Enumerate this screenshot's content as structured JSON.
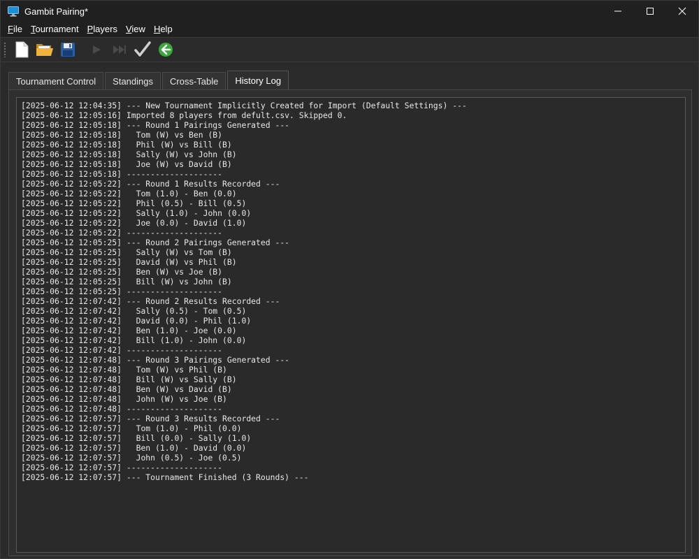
{
  "window": {
    "title": "Gambit Pairing*"
  },
  "menu": {
    "items": [
      {
        "label": "File",
        "mnemonic": "F",
        "rest": "ile"
      },
      {
        "label": "Tournament",
        "mnemonic": "T",
        "rest": "ournament"
      },
      {
        "label": "Players",
        "mnemonic": "P",
        "rest": "layers"
      },
      {
        "label": "View",
        "mnemonic": "V",
        "rest": "iew"
      },
      {
        "label": "Help",
        "mnemonic": "H",
        "rest": "elp"
      }
    ]
  },
  "toolbar": {
    "icons": [
      "new-document-icon",
      "open-folder-icon",
      "save-icon",
      "play-icon",
      "fast-forward-icon",
      "checkmark-icon",
      "back-arrow-icon"
    ]
  },
  "tabs": [
    {
      "label": "Tournament Control",
      "active": false
    },
    {
      "label": "Standings",
      "active": false
    },
    {
      "label": "Cross-Table",
      "active": false
    },
    {
      "label": "History Log",
      "active": true
    }
  ],
  "colors": {
    "background": "#2b2b2b",
    "accent_green": "#3aa83a",
    "titlebar": "#202020"
  },
  "history_log": [
    "[2025-06-12 12:04:35] --- New Tournament Implicitly Created for Import (Default Settings) ---",
    "[2025-06-12 12:05:16] Imported 8 players from defult.csv. Skipped 0.",
    "[2025-06-12 12:05:18] --- Round 1 Pairings Generated ---",
    "[2025-06-12 12:05:18]   Tom (W) vs Ben (B)",
    "[2025-06-12 12:05:18]   Phil (W) vs Bill (B)",
    "[2025-06-12 12:05:18]   Sally (W) vs John (B)",
    "[2025-06-12 12:05:18]   Joe (W) vs David (B)",
    "[2025-06-12 12:05:18] --------------------",
    "[2025-06-12 12:05:22] --- Round 1 Results Recorded ---",
    "[2025-06-12 12:05:22]   Tom (1.0) - Ben (0.0)",
    "[2025-06-12 12:05:22]   Phil (0.5) - Bill (0.5)",
    "[2025-06-12 12:05:22]   Sally (1.0) - John (0.0)",
    "[2025-06-12 12:05:22]   Joe (0.0) - David (1.0)",
    "[2025-06-12 12:05:22] --------------------",
    "[2025-06-12 12:05:25] --- Round 2 Pairings Generated ---",
    "[2025-06-12 12:05:25]   Sally (W) vs Tom (B)",
    "[2025-06-12 12:05:25]   David (W) vs Phil (B)",
    "[2025-06-12 12:05:25]   Ben (W) vs Joe (B)",
    "[2025-06-12 12:05:25]   Bill (W) vs John (B)",
    "[2025-06-12 12:05:25] --------------------",
    "[2025-06-12 12:07:42] --- Round 2 Results Recorded ---",
    "[2025-06-12 12:07:42]   Sally (0.5) - Tom (0.5)",
    "[2025-06-12 12:07:42]   David (0.0) - Phil (1.0)",
    "[2025-06-12 12:07:42]   Ben (1.0) - Joe (0.0)",
    "[2025-06-12 12:07:42]   Bill (1.0) - John (0.0)",
    "[2025-06-12 12:07:42] --------------------",
    "[2025-06-12 12:07:48] --- Round 3 Pairings Generated ---",
    "[2025-06-12 12:07:48]   Tom (W) vs Phil (B)",
    "[2025-06-12 12:07:48]   Bill (W) vs Sally (B)",
    "[2025-06-12 12:07:48]   Ben (W) vs David (B)",
    "[2025-06-12 12:07:48]   John (W) vs Joe (B)",
    "[2025-06-12 12:07:48] --------------------",
    "[2025-06-12 12:07:57] --- Round 3 Results Recorded ---",
    "[2025-06-12 12:07:57]   Tom (1.0) - Phil (0.0)",
    "[2025-06-12 12:07:57]   Bill (0.0) - Sally (1.0)",
    "[2025-06-12 12:07:57]   Ben (1.0) - David (0.0)",
    "[2025-06-12 12:07:57]   John (0.5) - Joe (0.5)",
    "[2025-06-12 12:07:57] --------------------",
    "[2025-06-12 12:07:57] --- Tournament Finished (3 Rounds) ---"
  ]
}
